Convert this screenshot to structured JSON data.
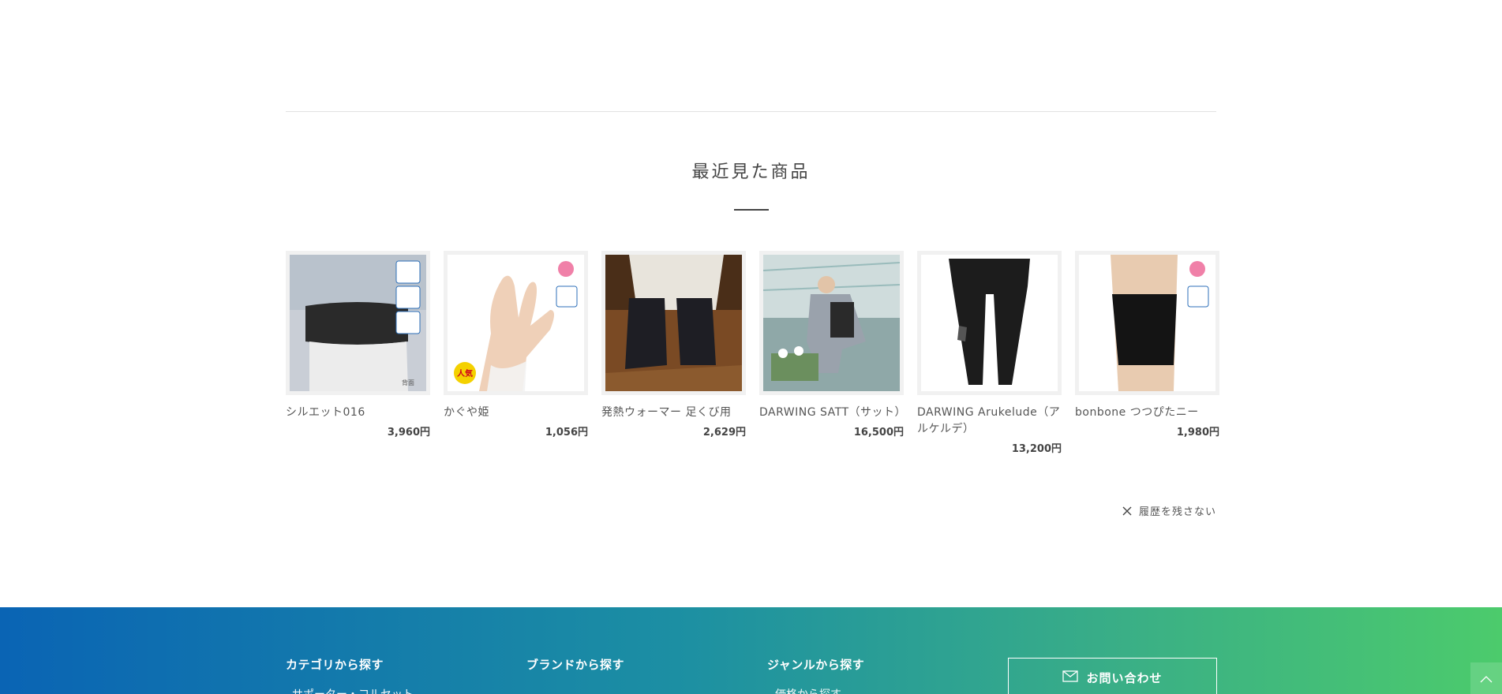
{
  "recent": {
    "title": "最近見た商品",
    "products": [
      {
        "name": "シルエット016",
        "price": "3,960円"
      },
      {
        "name": "かぐや姫",
        "price": "1,056円",
        "badge": "人気"
      },
      {
        "name": "発熱ウォーマー 足くび用",
        "price": "2,629円"
      },
      {
        "name": "DARWING SATT（サット）",
        "price": "16,500円"
      },
      {
        "name": "DARWING Arukelude（アルケルデ）",
        "price": "13,200円"
      },
      {
        "name": "bonbone つつぴたニー",
        "price": "1,980円"
      }
    ],
    "no_history_label": "履歴を残さない"
  },
  "footer": {
    "category_title": "カテゴリから探す",
    "category_first": "サポーター・コルセット",
    "brand_title": "ブランドから探す",
    "genre_title": "ジャンルから探す",
    "genre_first": "価格から探す",
    "contact_label": "お問い合わせ"
  },
  "colors": {
    "footer_gradient_start": "#0a64b4",
    "footer_gradient_end": "#4ccb6c",
    "badge_yellow": "#f4d100",
    "badge_pink": "#f080a8"
  }
}
